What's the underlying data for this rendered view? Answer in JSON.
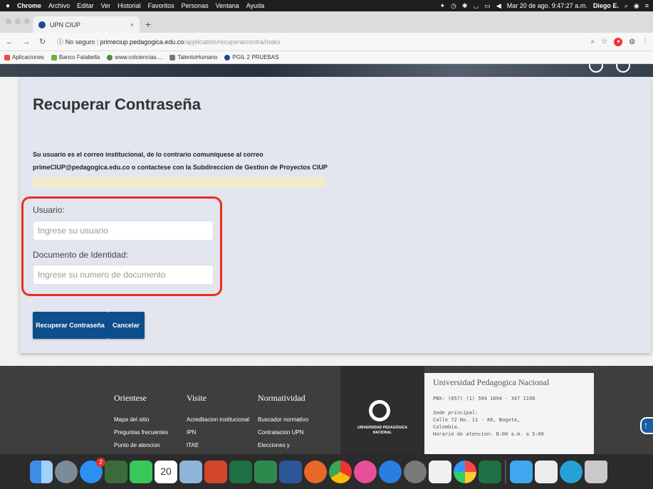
{
  "menubar": {
    "app": "Chrome",
    "items": [
      "Archivo",
      "Editar",
      "Ver",
      "Historial",
      "Favoritos",
      "Personas",
      "Ventana",
      "Ayuda"
    ],
    "datetime": "Mar 20 de ago.  9:47:27 a.m.",
    "user": "Diego E."
  },
  "browser": {
    "tab_title": "UPN CIUP",
    "not_secure": "No seguro",
    "url_host": "primeciup.pedagogica.edu.co",
    "url_path": "/application/recuperarcontra/index",
    "bookmarks": [
      "Aplicaciones",
      "Banco Falabella",
      "www.colciencias....",
      "TalentoHumano",
      "PGIL 2 PRUEBAS"
    ]
  },
  "form": {
    "title": "Recuperar Contraseña",
    "info_line1": "Su usuario es el correo institucional, de lo contrario comuniquese al correo",
    "info_line2": "primeCIUP@pedagogica.edu.co o contactese con la Subdireccion de Gestion de Proyectos CIUP",
    "usuario_label": "Usuario:",
    "usuario_placeholder": "Ingrese su usuario",
    "documento_label": "Documento de Identidad:",
    "documento_placeholder": "Ingrese su numero de documento",
    "submit_label": "Recuperar Contraseña",
    "cancel_label": "Cancelar"
  },
  "footer": {
    "columns": [
      {
        "heading": "Orientese",
        "items": [
          "Mapa del sitio",
          "Preguntas frecuentes",
          "Punto de atencion"
        ]
      },
      {
        "heading": "Visite",
        "items": [
          "Acreditacion institucional",
          "IPN",
          "ITAE"
        ]
      },
      {
        "heading": "Normatividad",
        "items": [
          "Buscador normativo",
          "Contratacion UPN",
          "Elecciones y"
        ]
      }
    ],
    "logo_text1": "UNIVERSIDAD PEDAGÓGICA",
    "logo_text2": "NACIONAL",
    "university": "Universidad Pedagogica Nacional",
    "pbx": "PBX: (057) (1) 594 1894 - 347 1190",
    "sede_label": "Sede principal:",
    "address1": "Calle 72 No. 11 - 86, Bogota,",
    "address2": "Colombia.",
    "horario": "Horario de atencion: 8:00 a.m. a 5:00"
  },
  "dock": {
    "app_store_badge": "2",
    "calendar_month": "AGO",
    "calendar_day": "20"
  }
}
